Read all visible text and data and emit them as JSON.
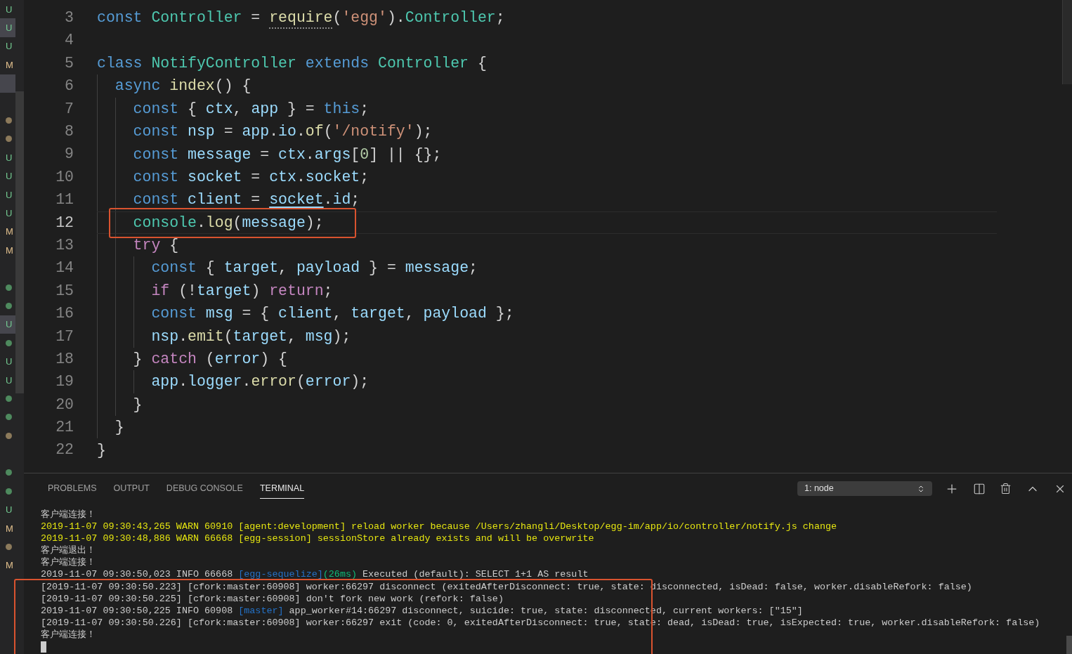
{
  "explorer_decorations": [
    {
      "kind": "letter",
      "text": "U",
      "color": "#73c991",
      "selected": false
    },
    {
      "kind": "letter",
      "text": "U",
      "color": "#73c991",
      "selected": true
    },
    {
      "kind": "letter",
      "text": "U",
      "color": "#73c991",
      "selected": false
    },
    {
      "kind": "letter",
      "text": "M",
      "color": "#e2c08d",
      "selected": false
    },
    {
      "kind": "empty",
      "selected": true
    },
    {
      "kind": "empty",
      "selected": false
    },
    {
      "kind": "dot",
      "color": "#8c7a5b",
      "selected": false
    },
    {
      "kind": "dot",
      "color": "#8c7a5b",
      "selected": false
    },
    {
      "kind": "letter",
      "text": "U",
      "color": "#73c991",
      "selected": false
    },
    {
      "kind": "letter",
      "text": "U",
      "color": "#73c991",
      "selected": false
    },
    {
      "kind": "letter",
      "text": "U",
      "color": "#73c991",
      "selected": false
    },
    {
      "kind": "letter",
      "text": "U",
      "color": "#73c991",
      "selected": false
    },
    {
      "kind": "letter",
      "text": "M",
      "color": "#e2c08d",
      "selected": false
    },
    {
      "kind": "letter",
      "text": "M",
      "color": "#e2c08d",
      "selected": false
    },
    {
      "kind": "empty",
      "selected": false
    },
    {
      "kind": "dot",
      "color": "#4e8a5e",
      "selected": false
    },
    {
      "kind": "dot",
      "color": "#4e8a5e",
      "selected": false
    },
    {
      "kind": "letter",
      "text": "U",
      "color": "#73c991",
      "selected": true
    },
    {
      "kind": "dot",
      "color": "#4e8a5e",
      "selected": false
    },
    {
      "kind": "letter",
      "text": "U",
      "color": "#73c991",
      "selected": false
    },
    {
      "kind": "letter",
      "text": "U",
      "color": "#73c991",
      "selected": false
    },
    {
      "kind": "dot",
      "color": "#4e8a5e",
      "selected": false
    },
    {
      "kind": "dot",
      "color": "#4e8a5e",
      "selected": false
    },
    {
      "kind": "dot",
      "color": "#8c7a5b",
      "selected": false
    },
    {
      "kind": "empty",
      "selected": false
    },
    {
      "kind": "dot",
      "color": "#4e8a5e",
      "selected": false
    },
    {
      "kind": "dot",
      "color": "#4e8a5e",
      "selected": false
    },
    {
      "kind": "letter",
      "text": "U",
      "color": "#73c991",
      "selected": false
    },
    {
      "kind": "letter",
      "text": "M",
      "color": "#e2c08d",
      "selected": false
    },
    {
      "kind": "dot",
      "color": "#8c7a5b",
      "selected": false
    },
    {
      "kind": "letter",
      "text": "M",
      "color": "#e2c08d",
      "selected": false
    }
  ],
  "editor": {
    "lines": [
      {
        "number": "3",
        "current": false,
        "tokens": [
          {
            "kind": "kw",
            "text": "const "
          },
          {
            "kind": "cls",
            "text": "Controller"
          },
          {
            "kind": "p",
            "text": " = "
          },
          {
            "kind": "fnh",
            "text": "require"
          },
          {
            "kind": "p",
            "text": "("
          },
          {
            "kind": "str",
            "text": "'egg'"
          },
          {
            "kind": "p",
            "text": ")."
          },
          {
            "kind": "cls",
            "text": "Controller"
          },
          {
            "kind": "p",
            "text": ";"
          }
        ]
      },
      {
        "number": "4",
        "current": false
      },
      {
        "number": "5",
        "current": false,
        "tokens": [
          {
            "kind": "kw",
            "text": "class "
          },
          {
            "kind": "cls",
            "text": "NotifyController "
          },
          {
            "kind": "kw",
            "text": "extends "
          },
          {
            "kind": "cls",
            "text": "Controller"
          },
          {
            "kind": "p",
            "text": " {"
          }
        ]
      },
      {
        "number": "6",
        "current": false,
        "tokens": [
          {
            "kind": "kw",
            "text": "  async "
          },
          {
            "kind": "fn",
            "text": "index"
          },
          {
            "kind": "p",
            "text": "() {"
          }
        ]
      },
      {
        "number": "7",
        "current": false,
        "tokens": [
          {
            "kind": "kw",
            "text": "    const"
          },
          {
            "kind": "p",
            "text": " { "
          },
          {
            "kind": "var",
            "text": "ctx"
          },
          {
            "kind": "p",
            "text": ", "
          },
          {
            "kind": "var",
            "text": "app"
          },
          {
            "kind": "p",
            "text": " } = "
          },
          {
            "kind": "kw",
            "text": "this"
          },
          {
            "kind": "p",
            "text": ";"
          }
        ]
      },
      {
        "number": "8",
        "current": false,
        "tokens": [
          {
            "kind": "kw",
            "text": "    const "
          },
          {
            "kind": "var",
            "text": "nsp"
          },
          {
            "kind": "p",
            "text": " = "
          },
          {
            "kind": "var",
            "text": "app"
          },
          {
            "kind": "p",
            "text": "."
          },
          {
            "kind": "var",
            "text": "io"
          },
          {
            "kind": "p",
            "text": "."
          },
          {
            "kind": "fn",
            "text": "of"
          },
          {
            "kind": "p",
            "text": "("
          },
          {
            "kind": "str",
            "text": "'/notify'"
          },
          {
            "kind": "p",
            "text": ");"
          }
        ]
      },
      {
        "number": "9",
        "current": false,
        "tokens": [
          {
            "kind": "kw",
            "text": "    const "
          },
          {
            "kind": "var",
            "text": "message"
          },
          {
            "kind": "p",
            "text": " = "
          },
          {
            "kind": "var",
            "text": "ctx"
          },
          {
            "kind": "p",
            "text": "."
          },
          {
            "kind": "var",
            "text": "args"
          },
          {
            "kind": "p",
            "text": "["
          },
          {
            "kind": "num",
            "text": "0"
          },
          {
            "kind": "p",
            "text": "] || {};"
          }
        ]
      },
      {
        "number": "10",
        "current": false,
        "tokens": [
          {
            "kind": "kw",
            "text": "    const "
          },
          {
            "kind": "var",
            "text": "socket"
          },
          {
            "kind": "p",
            "text": " = "
          },
          {
            "kind": "var",
            "text": "ctx"
          },
          {
            "kind": "p",
            "text": "."
          },
          {
            "kind": "var",
            "text": "socket"
          },
          {
            "kind": "p",
            "text": ";"
          }
        ]
      },
      {
        "number": "11",
        "current": false,
        "tokens": [
          {
            "kind": "kw",
            "text": "    const "
          },
          {
            "kind": "var",
            "text": "client"
          },
          {
            "kind": "p",
            "text": " = "
          },
          {
            "kind": "varu",
            "text": "socket"
          },
          {
            "kind": "p",
            "text": "."
          },
          {
            "kind": "var",
            "text": "id"
          },
          {
            "kind": "p",
            "text": ";"
          }
        ]
      },
      {
        "number": "12",
        "current": true,
        "tokens": [
          {
            "kind": "cls",
            "text": "    console"
          },
          {
            "kind": "p",
            "text": "."
          },
          {
            "kind": "fn",
            "text": "log"
          },
          {
            "kind": "p",
            "text": "("
          },
          {
            "kind": "var",
            "text": "message"
          },
          {
            "kind": "p",
            "text": ");"
          }
        ]
      },
      {
        "number": "13",
        "current": false,
        "tokens": [
          {
            "kind": "ctl",
            "text": "    try"
          },
          {
            "kind": "p",
            "text": " {"
          }
        ]
      },
      {
        "number": "14",
        "current": false,
        "tokens": [
          {
            "kind": "kw",
            "text": "      const"
          },
          {
            "kind": "p",
            "text": " { "
          },
          {
            "kind": "var",
            "text": "target"
          },
          {
            "kind": "p",
            "text": ", "
          },
          {
            "kind": "var",
            "text": "payload"
          },
          {
            "kind": "p",
            "text": " } = "
          },
          {
            "kind": "var",
            "text": "message"
          },
          {
            "kind": "p",
            "text": ";"
          }
        ]
      },
      {
        "number": "15",
        "current": false,
        "tokens": [
          {
            "kind": "ctl",
            "text": "      if"
          },
          {
            "kind": "p",
            "text": " (!"
          },
          {
            "kind": "var",
            "text": "target"
          },
          {
            "kind": "p",
            "text": ") "
          },
          {
            "kind": "ctl",
            "text": "return"
          },
          {
            "kind": "p",
            "text": ";"
          }
        ]
      },
      {
        "number": "16",
        "current": false,
        "tokens": [
          {
            "kind": "kw",
            "text": "      const "
          },
          {
            "kind": "var",
            "text": "msg"
          },
          {
            "kind": "p",
            "text": " = { "
          },
          {
            "kind": "var",
            "text": "client"
          },
          {
            "kind": "p",
            "text": ", "
          },
          {
            "kind": "var",
            "text": "target"
          },
          {
            "kind": "p",
            "text": ", "
          },
          {
            "kind": "var",
            "text": "payload"
          },
          {
            "kind": "p",
            "text": " };"
          }
        ]
      },
      {
        "number": "17",
        "current": false,
        "tokens": [
          {
            "kind": "var",
            "text": "      nsp"
          },
          {
            "kind": "p",
            "text": "."
          },
          {
            "kind": "fn",
            "text": "emit"
          },
          {
            "kind": "p",
            "text": "("
          },
          {
            "kind": "var",
            "text": "target"
          },
          {
            "kind": "p",
            "text": ", "
          },
          {
            "kind": "var",
            "text": "msg"
          },
          {
            "kind": "p",
            "text": ");"
          }
        ]
      },
      {
        "number": "18",
        "current": false,
        "tokens": [
          {
            "kind": "p",
            "text": "    } "
          },
          {
            "kind": "ctl",
            "text": "catch"
          },
          {
            "kind": "p",
            "text": " ("
          },
          {
            "kind": "var",
            "text": "error"
          },
          {
            "kind": "p",
            "text": ") {"
          }
        ]
      },
      {
        "number": "19",
        "current": false,
        "tokens": [
          {
            "kind": "var",
            "text": "      app"
          },
          {
            "kind": "p",
            "text": "."
          },
          {
            "kind": "var",
            "text": "logger"
          },
          {
            "kind": "p",
            "text": "."
          },
          {
            "kind": "fn",
            "text": "error"
          },
          {
            "kind": "p",
            "text": "("
          },
          {
            "kind": "var",
            "text": "error"
          },
          {
            "kind": "p",
            "text": ");"
          }
        ]
      },
      {
        "number": "20",
        "current": false,
        "tokens": [
          {
            "kind": "p",
            "text": "    }"
          }
        ]
      },
      {
        "number": "21",
        "current": false,
        "tokens": [
          {
            "kind": "p",
            "text": "  }"
          }
        ]
      },
      {
        "number": "22",
        "current": false,
        "tokens": [
          {
            "kind": "p",
            "text": "}"
          }
        ]
      }
    ]
  },
  "panel": {
    "tabs": [
      {
        "label": "PROBLEMS",
        "selected": false
      },
      {
        "label": "OUTPUT",
        "selected": false
      },
      {
        "label": "DEBUG CONSOLE",
        "selected": false
      },
      {
        "label": "TERMINAL",
        "selected": true
      }
    ],
    "terminal_select": {
      "value": "1: node"
    },
    "terminal_lines": [
      [
        {
          "kind": "p",
          "text": "客户端连接！"
        }
      ],
      [
        {
          "kind": "w",
          "text": "2019-11-07 09:30:43,265 WARN 60910 [agent:development] reload worker because /Users/zhangli/Desktop/egg-im/app/io/controller/notify.js change"
        }
      ],
      [
        {
          "kind": "w",
          "text": "2019-11-07 09:30:48,886 WARN 66668 [egg-session] sessionStore already exists and will be overwrite"
        }
      ],
      [
        {
          "kind": "p",
          "text": "客户端退出！"
        }
      ],
      [
        {
          "kind": "p",
          "text": "客户端连接！"
        }
      ],
      [
        {
          "kind": "p",
          "text": "2019-11-07 09:30:50,023 INFO 66668 "
        },
        {
          "kind": "b",
          "text": "[egg-sequelize]"
        },
        {
          "kind": "g",
          "text": "(26ms)"
        },
        {
          "kind": "p",
          "text": " Executed (default): SELECT 1+1 AS result"
        }
      ],
      [
        {
          "kind": "p",
          "text": "[2019-11-07 09:30:50.223] [cfork:master:60908] worker:66297 disconnect (exitedAfterDisconnect: true, state: disconnected, isDead: false, worker.disableRefork: false)"
        }
      ],
      [
        {
          "kind": "p",
          "text": "[2019-11-07 09:30:50.225] [cfork:master:60908] don't fork new work (refork: false)"
        }
      ],
      [
        {
          "kind": "p",
          "text": "2019-11-07 09:30:50,225 INFO 60908 "
        },
        {
          "kind": "b",
          "text": "[master]"
        },
        {
          "kind": "p",
          "text": " app_worker#14:66297 disconnect, suicide: true, state: disconnected, current workers: [\"15\"]"
        }
      ],
      [
        {
          "kind": "p",
          "text": "[2019-11-07 09:30:50.226] [cfork:master:60908] worker:66297 exit (code: 0, exitedAfterDisconnect: true, state: dead, isDead: true, isExpected: true, worker.disableRefork: false)"
        }
      ],
      [
        {
          "kind": "p",
          "text": "客户端连接！"
        }
      ]
    ]
  }
}
